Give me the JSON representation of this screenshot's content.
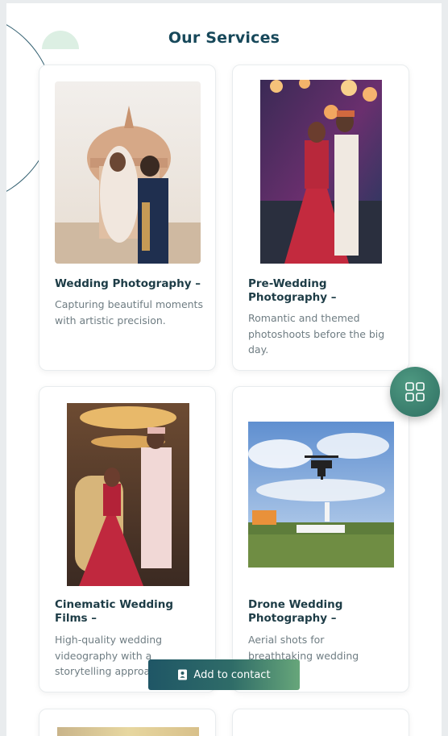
{
  "section_title": "Our Services",
  "services": [
    {
      "title": "Wedding Photography –",
      "description": "Capturing beautiful moments with artistic precision."
    },
    {
      "title": "Pre-Wedding Photography –",
      "description": "Romantic and themed photoshoots before the big day."
    },
    {
      "title": "Cinematic Wedding Films –",
      "description": "High-quality wedding videography with a storytelling approach."
    },
    {
      "title": "Drone Wedding Photography –",
      "description": "Aerial shots for breathtaking wedding visuals."
    }
  ],
  "contact_button": {
    "label": "Add to contact",
    "icon": "contact-card-icon"
  },
  "fab": {
    "icon": "grid-menu-icon"
  },
  "colors": {
    "title": "#17485a",
    "accent": "#2e6f62",
    "card_text": "#1d3c46"
  }
}
